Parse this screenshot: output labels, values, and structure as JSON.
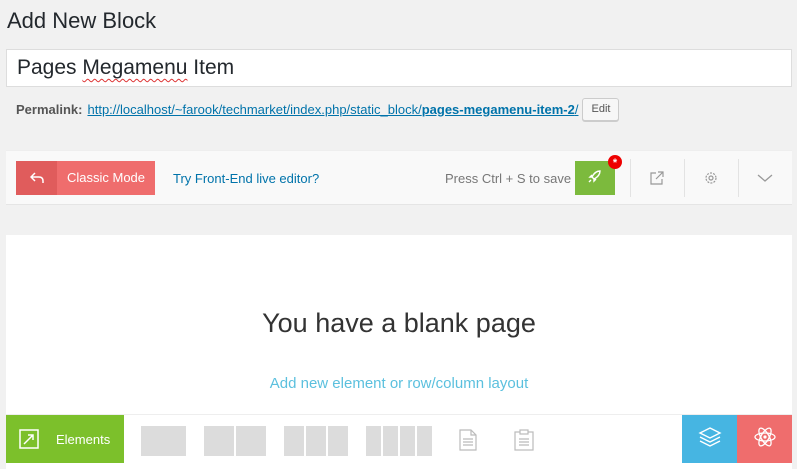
{
  "page": {
    "heading": "Add New Block"
  },
  "title": {
    "before": "Pages ",
    "misspelled": "Megamenu",
    "after": " Item"
  },
  "permalink": {
    "label": "Permalink:",
    "url_prefix": "http://localhost/~farook/techmarket/index.php/static_block/",
    "slug": "pages-megamenu-item-2",
    "url_suffix": "/",
    "edit_label": "Edit"
  },
  "toolbar": {
    "classic_mode_label": "Classic Mode",
    "frontend_link": "Try Front-End live editor?",
    "save_hint": "Press Ctrl + S to save",
    "publish_badge": "*"
  },
  "canvas": {
    "blank_title": "You have a blank page",
    "add_element_link": "Add new element or row/column layout"
  },
  "bottom_bar": {
    "elements_label": "Elements"
  },
  "colors": {
    "classic_red": "#ef6d6d",
    "publish_green": "#7cba3d",
    "elements_green": "#7cc02b",
    "layers_blue": "#46b5e2",
    "link_blue": "#0073aa"
  },
  "icons": {
    "classic": "undo-arrow-icon",
    "publish": "rocket-icon",
    "share": "external-link-icon",
    "settings": "gear-icon",
    "collapse": "chevron-down-icon",
    "elements": "expand-icon",
    "text_block": "document-icon",
    "template": "clipboard-icon",
    "layers": "layers-icon",
    "atom": "atom-icon"
  }
}
